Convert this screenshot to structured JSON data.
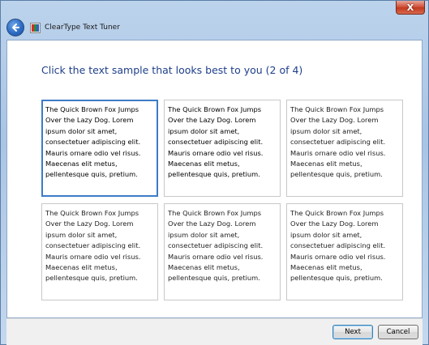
{
  "window": {
    "title": "ClearType Text Tuner",
    "close_label": "X"
  },
  "main": {
    "heading": "Click the text sample that looks best to you (2 of 4)"
  },
  "samples": [
    {
      "text": "The Quick Brown Fox Jumps Over the Lazy Dog. Lorem ipsum dolor sit amet, consectetuer adipiscing elit. Mauris ornare odio vel risus. Maecenas elit metus, pellentesque quis, pretium.",
      "selected": true
    },
    {
      "text": "The Quick Brown Fox Jumps Over the Lazy Dog. Lorem ipsum dolor sit amet, consectetuer adipiscing elit. Mauris ornare odio vel risus. Maecenas elit metus, pellentesque quis, pretium.",
      "selected": false
    },
    {
      "text": "The Quick Brown Fox Jumps Over the Lazy Dog. Lorem ipsum dolor sit amet, consectetuer adipiscing elit. Mauris ornare odio vel risus. Maecenas elit metus, pellentesque quis, pretium.",
      "selected": false
    },
    {
      "text": "The Quick Brown Fox Jumps Over the Lazy Dog. Lorem ipsum dolor sit amet, consectetuer adipiscing elit. Mauris ornare odio vel risus. Maecenas elit metus, pellentesque quis, pretium.",
      "selected": false
    },
    {
      "text": "The Quick Brown Fox Jumps Over the Lazy Dog. Lorem ipsum dolor sit amet, consectetuer adipiscing elit. Mauris ornare odio vel risus. Maecenas elit metus, pellentesque quis, pretium.",
      "selected": false
    },
    {
      "text": "The Quick Brown Fox Jumps Over the Lazy Dog. Lorem ipsum dolor sit amet, consectetuer adipiscing elit. Mauris ornare odio vel risus. Maecenas elit metus, pellentesque quis, pretium.",
      "selected": false
    }
  ],
  "footer": {
    "next_label": "Next",
    "cancel_label": "Cancel"
  },
  "icons": {
    "back": "back-arrow-icon",
    "app": "cleartype-app-icon",
    "close": "close-icon"
  },
  "colors": {
    "heading": "#1e3f8a",
    "selection_border": "#3d7bc7",
    "close_button": "#c23a1f"
  }
}
